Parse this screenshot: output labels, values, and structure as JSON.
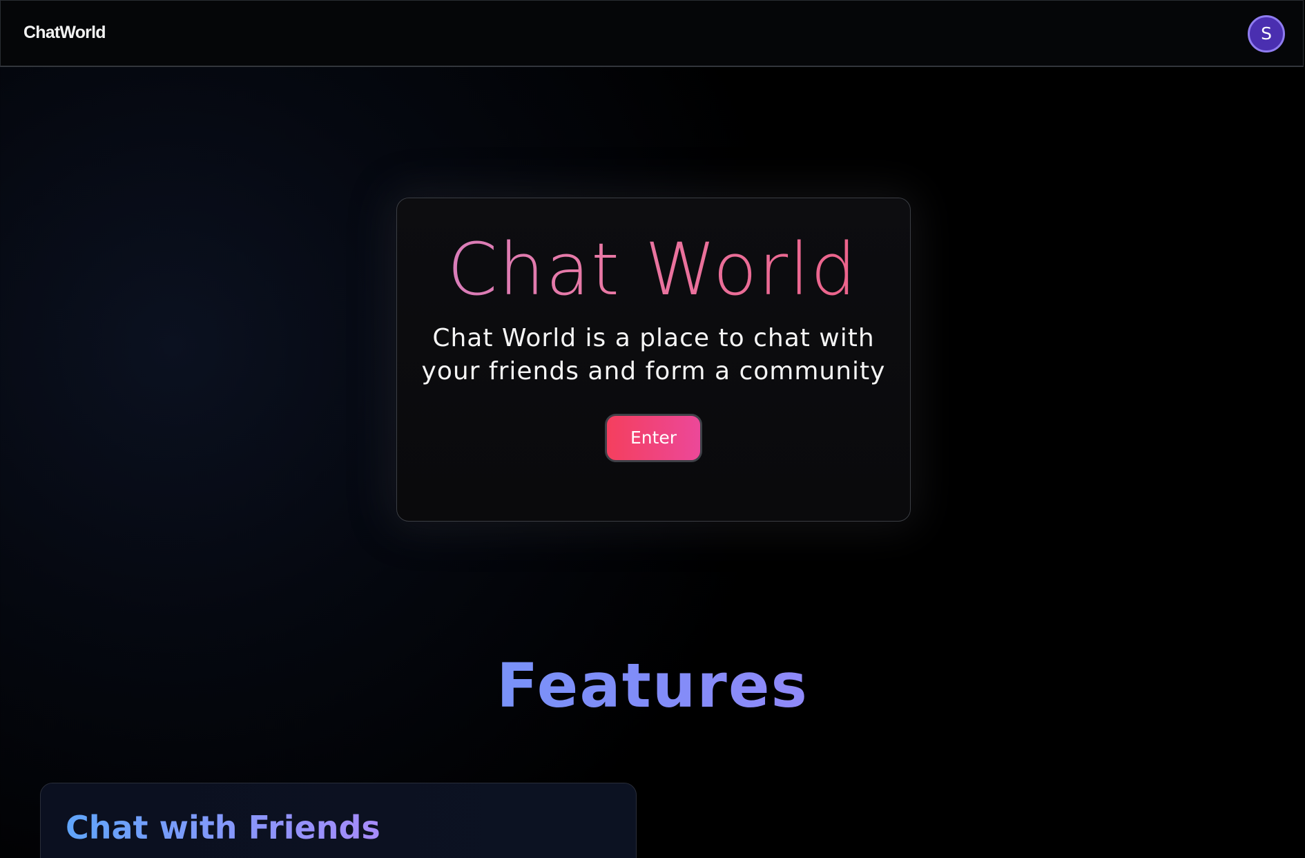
{
  "navbar": {
    "brand": "ChatWorld",
    "avatar_initial": "S"
  },
  "hero": {
    "title": "Chat World",
    "subtitle_line1": "Chat World is a place to chat with",
    "subtitle_line2": "your friends and form a community",
    "enter_label": "Enter"
  },
  "features": {
    "heading": "Features",
    "cards": [
      {
        "title": "Chat with Friends"
      }
    ]
  },
  "colors": {
    "avatar_bg": "#4a2fb0",
    "avatar_ring": "#8f7cf0",
    "enter_gradient_start": "#f43f5e",
    "enter_gradient_end": "#ec4899",
    "title_gradient_start": "#a78bfa",
    "title_gradient_end": "#f43f5e",
    "features_gradient_start": "#60a5fa",
    "features_gradient_end": "#c084fc"
  }
}
